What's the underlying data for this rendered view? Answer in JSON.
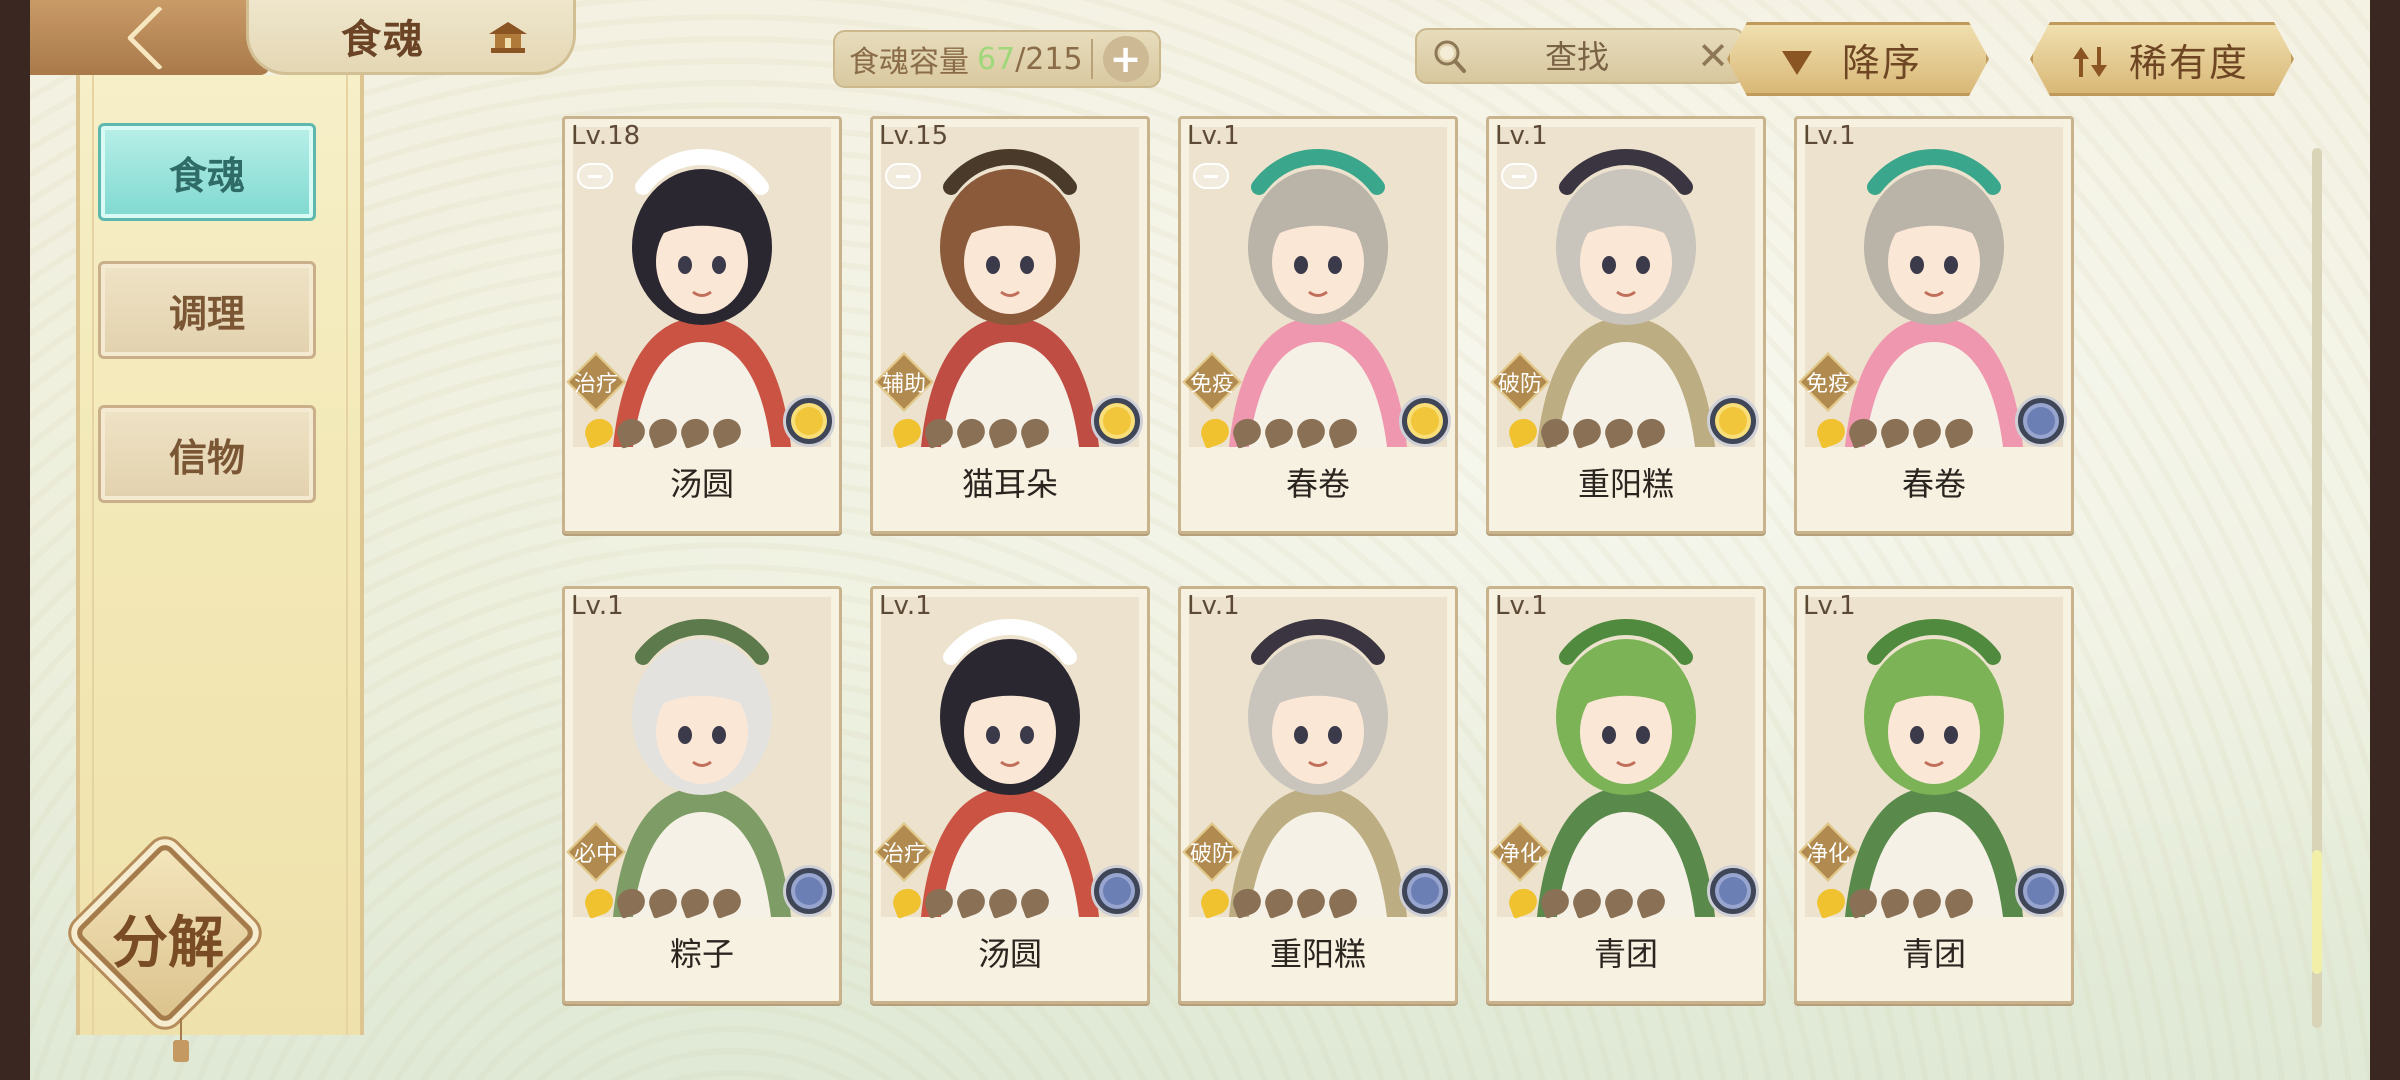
{
  "header": {
    "title": "食魂",
    "capacity_label": "食魂容量",
    "capacity_used": "67",
    "capacity_sep": "/",
    "capacity_total": "215",
    "add_label": "+",
    "search_placeholder": "查找",
    "clear_label": "✕",
    "sort_order_label": "降序",
    "sort_key_label": "稀有度"
  },
  "sidebar": {
    "items": [
      {
        "label": "食魂",
        "active": true
      },
      {
        "label": "调理",
        "active": false
      },
      {
        "label": "信物",
        "active": false
      }
    ],
    "decompose_label": "分解"
  },
  "colors": {
    "accent_active": "#7fd9d0",
    "capacity_used": "#9ed87a",
    "star_on": "#f0c230"
  },
  "cards": [
    {
      "level": "Lv.18",
      "name": "汤圆",
      "role": "治疗",
      "stars_on": 1,
      "stars_total": 5,
      "locked_icon": true,
      "medal": "gold-flower-icon",
      "art_hair": "#2b2730",
      "art_hat": "#ffffff",
      "art_accent": "#c43a2a"
    },
    {
      "level": "Lv.15",
      "name": "猫耳朵",
      "role": "辅助",
      "stars_on": 1,
      "stars_total": 5,
      "locked_icon": true,
      "medal": "gold-flower-icon",
      "art_hair": "#8a5a3a",
      "art_hat": "#4a3a2a",
      "art_accent": "#b8332b"
    },
    {
      "level": "Lv.1",
      "name": "春卷",
      "role": "免疫",
      "stars_on": 1,
      "stars_total": 5,
      "locked_icon": true,
      "medal": "gold-flower-icon",
      "art_hair": "#b9b3a8",
      "art_hat": "#3aa68b",
      "art_accent": "#f08aa8"
    },
    {
      "level": "Lv.1",
      "name": "重阳糕",
      "role": "破防",
      "stars_on": 1,
      "stars_total": 5,
      "locked_icon": true,
      "medal": "gold-flower-icon",
      "art_hair": "#c9c4bc",
      "art_hat": "#3a3540",
      "art_accent": "#b5a374"
    },
    {
      "level": "Lv.1",
      "name": "春卷",
      "role": "免疫",
      "stars_on": 1,
      "stars_total": 5,
      "locked_icon": false,
      "medal": "blue-flower-icon",
      "art_hair": "#b9b3a8",
      "art_hat": "#3aa68b",
      "art_accent": "#f08aa8"
    },
    {
      "level": "Lv.1",
      "name": "粽子",
      "role": "必中",
      "stars_on": 1,
      "stars_total": 5,
      "locked_icon": false,
      "medal": "blue-flower-icon",
      "art_hair": "#e4e2de",
      "art_hat": "#5d7a4c",
      "art_accent": "#6b8f54"
    },
    {
      "level": "Lv.1",
      "name": "汤圆",
      "role": "治疗",
      "stars_on": 1,
      "stars_total": 5,
      "locked_icon": false,
      "medal": "blue-flower-icon",
      "art_hair": "#2b2730",
      "art_hat": "#ffffff",
      "art_accent": "#c43a2a"
    },
    {
      "level": "Lv.1",
      "name": "重阳糕",
      "role": "破防",
      "stars_on": 1,
      "stars_total": 5,
      "locked_icon": false,
      "medal": "blue-flower-icon",
      "art_hair": "#c9c4bc",
      "art_hat": "#3a3540",
      "art_accent": "#b5a374"
    },
    {
      "level": "Lv.1",
      "name": "青团",
      "role": "净化",
      "stars_on": 1,
      "stars_total": 5,
      "locked_icon": false,
      "medal": "blue-flower-icon",
      "art_hair": "#7cb357",
      "art_hat": "#4f8a3e",
      "art_accent": "#3f7a35"
    },
    {
      "level": "Lv.1",
      "name": "青团",
      "role": "净化",
      "stars_on": 1,
      "stars_total": 5,
      "locked_icon": false,
      "medal": "blue-flower-icon",
      "art_hair": "#7cb357",
      "art_hat": "#4f8a3e",
      "art_accent": "#3f7a35"
    }
  ]
}
